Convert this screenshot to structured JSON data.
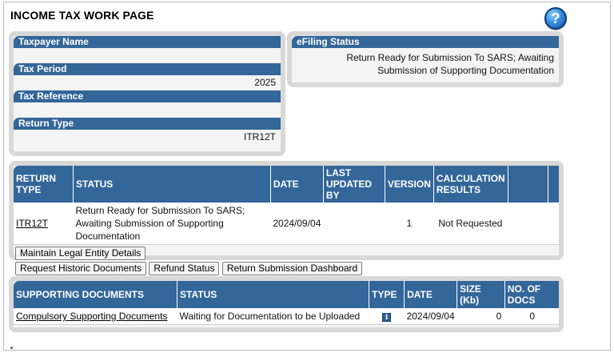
{
  "page": {
    "title": "INCOME TAX WORK PAGE",
    "help_icon": "question-mark-icon"
  },
  "taxpayer_panel": {
    "taxpayer_name_label": "Taxpayer Name",
    "taxpayer_name_value": "",
    "tax_period_label": "Tax Period",
    "tax_period_value": "2025",
    "tax_reference_label": "Tax Reference",
    "tax_reference_value": "",
    "return_type_label": "Return Type",
    "return_type_value": "ITR12T"
  },
  "efiling_panel": {
    "label": "eFiling Status",
    "value": "Return Ready for Submission To SARS; Awaiting Submission of Supporting Documentation"
  },
  "returns_table": {
    "headers": {
      "return_type": "RETURN TYPE",
      "status": "STATUS",
      "date": "DATE",
      "last_updated_by": "LAST UPDATED BY",
      "version": "VERSION",
      "calculation_results": "CALCULATION RESULTS"
    },
    "rows": [
      {
        "return_type": "ITR12T",
        "status": "Return Ready for Submission To SARS; Awaiting Submission of Supporting Documentation",
        "date": "2024/09/04",
        "last_updated_by": "",
        "version": "1",
        "calculation_results": "Not Requested"
      }
    ]
  },
  "buttons": {
    "maintain_legal_entity": "Maintain Legal Entity Details",
    "request_historic": "Request Historic Documents",
    "refund_status": "Refund Status",
    "return_submission_dashboard": "Return Submission Dashboard"
  },
  "docs_table": {
    "headers": {
      "supporting_documents": "SUPPORTING DOCUMENTS",
      "status": "STATUS",
      "type": "TYPE",
      "date": "DATE",
      "size": "SIZE (Kb)",
      "no_of_docs": "NO. OF DOCS"
    },
    "rows": [
      {
        "name": "Compulsory Supporting Documents",
        "status": "Waiting for Documentation to be Uploaded",
        "type_icon": "info-icon",
        "type_glyph": "i",
        "date": "2024/09/04",
        "size": "0",
        "no_of_docs": "0"
      }
    ]
  },
  "colors": {
    "header_blue": "#336699",
    "panel_grey": "#d8d8d8"
  }
}
